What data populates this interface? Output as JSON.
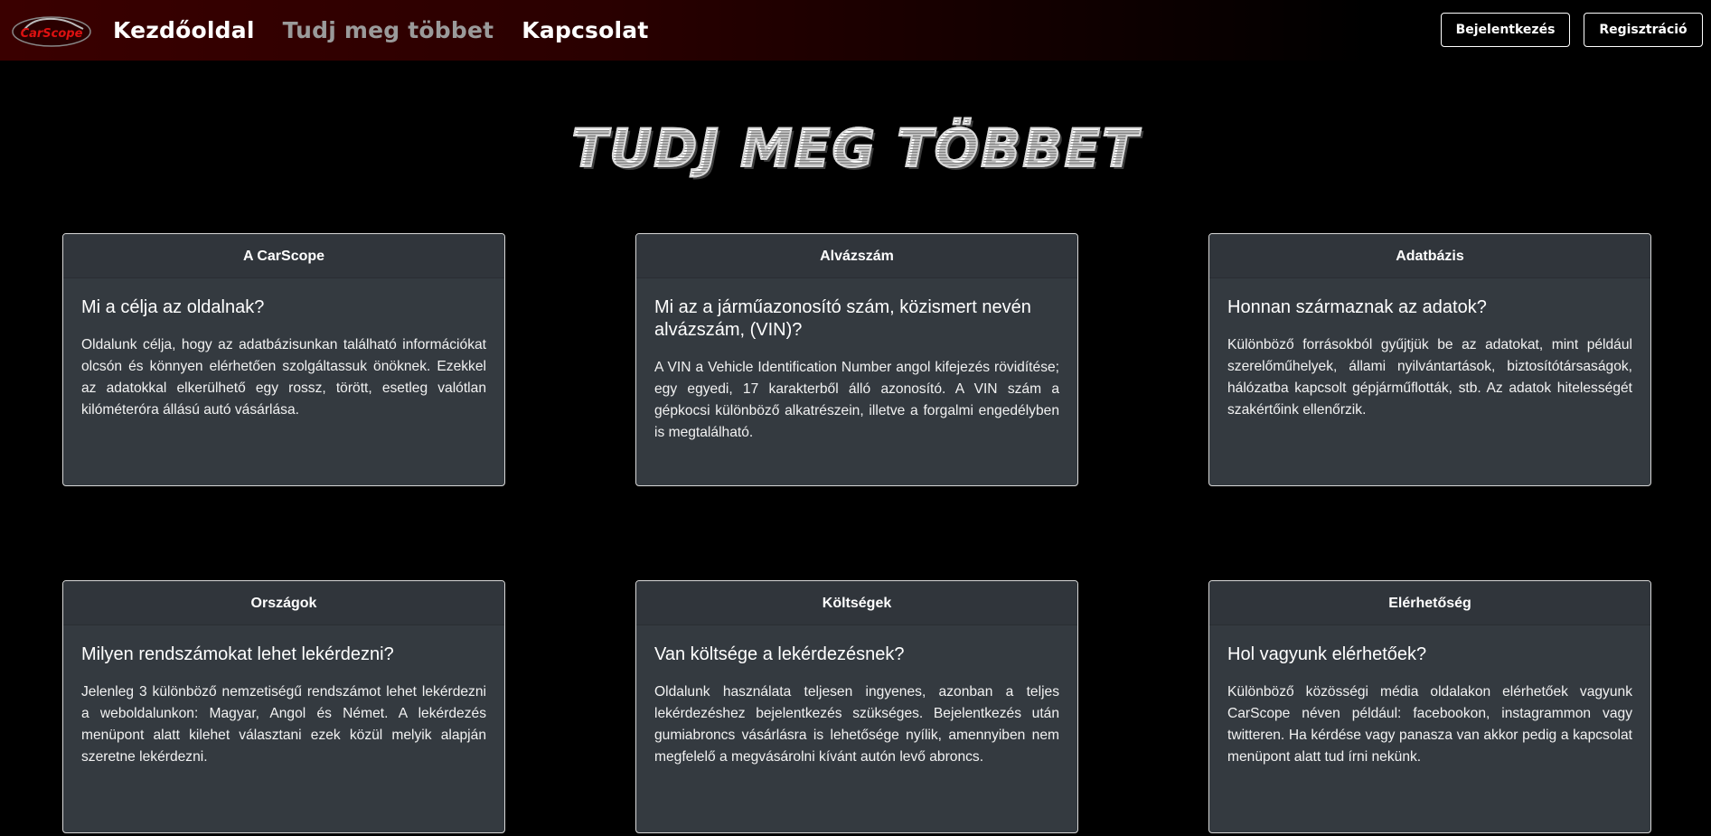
{
  "nav": {
    "logo_text": "CarScope",
    "links": [
      {
        "label": "Kezdőoldal"
      },
      {
        "label": "Tudj meg többet"
      },
      {
        "label": "Kapcsolat"
      }
    ],
    "login_label": "Bejelentkezés",
    "register_label": "Regisztráció"
  },
  "page_title": "Tudj meg többet",
  "cards": [
    {
      "header": "A CarScope",
      "title": "Mi a célja az oldalnak?",
      "text": "Oldalunk célja, hogy az adatbázisunkan található információkat olcsón és könnyen elérhetően szolgáltassuk önöknek. Ezekkel az adatokkal elkerülhető egy rossz, törött, esetleg valótlan kilóméteróra állású autó vásárlása."
    },
    {
      "header": "Alvázszám",
      "title": "Mi az a járműazonosító szám, közismert nevén alvázszám, (VIN)?",
      "text": "A VIN a Vehicle Identification Number angol kifejezés rövidítése; egy egyedi, 17 karakterből álló azonosító. A VIN szám a gépkocsi különböző alkatrészein, illetve a forgalmi engedélyben is megtalálható."
    },
    {
      "header": "Adatbázis",
      "title": "Honnan származnak az adatok?",
      "text": "Különböző forrásokból gyűjtjük be az adatokat, mint például szerelőműhelyek, állami nyilvántartások, biztosítótársaságok, hálózatba kapcsolt gépjárműflották, stb. Az adatok hitelességét szakértőink ellenőrzik."
    },
    {
      "header": "Országok",
      "title": "Milyen rendszámokat lehet lekérdezni?",
      "text": "Jelenleg 3 különböző nemzetiségű rendszámot lehet lekérdezni a weboldalunkon: Magyar, Angol és Német. A lekérdezés menüpont alatt kilehet választani ezek közül melyik alapján szeretne lekérdezni."
    },
    {
      "header": "Költségek",
      "title": "Van költsége a lekérdezésnek?",
      "text": "Oldalunk használata teljesen ingyenes, azonban a teljes lekérdezéshez bejelentkezés szükséges. Bejelentkezés után gumiabroncs vásárlásra is lehetősége nyílik, amennyiben nem megfelelő a megvásárolni kívánt autón levő abroncs."
    },
    {
      "header": "Elérhetőség",
      "title": "Hol vagyunk elérhetőek?",
      "text": "Különböző közösségi média oldalakon elérhetőek vagyunk CarScope néven például: facebookon, instagrammon vagy twitteren. Ha kérdése vagy panasza van akkor pedig a kapcsolat menüpont alatt tud írni nekünk."
    }
  ]
}
